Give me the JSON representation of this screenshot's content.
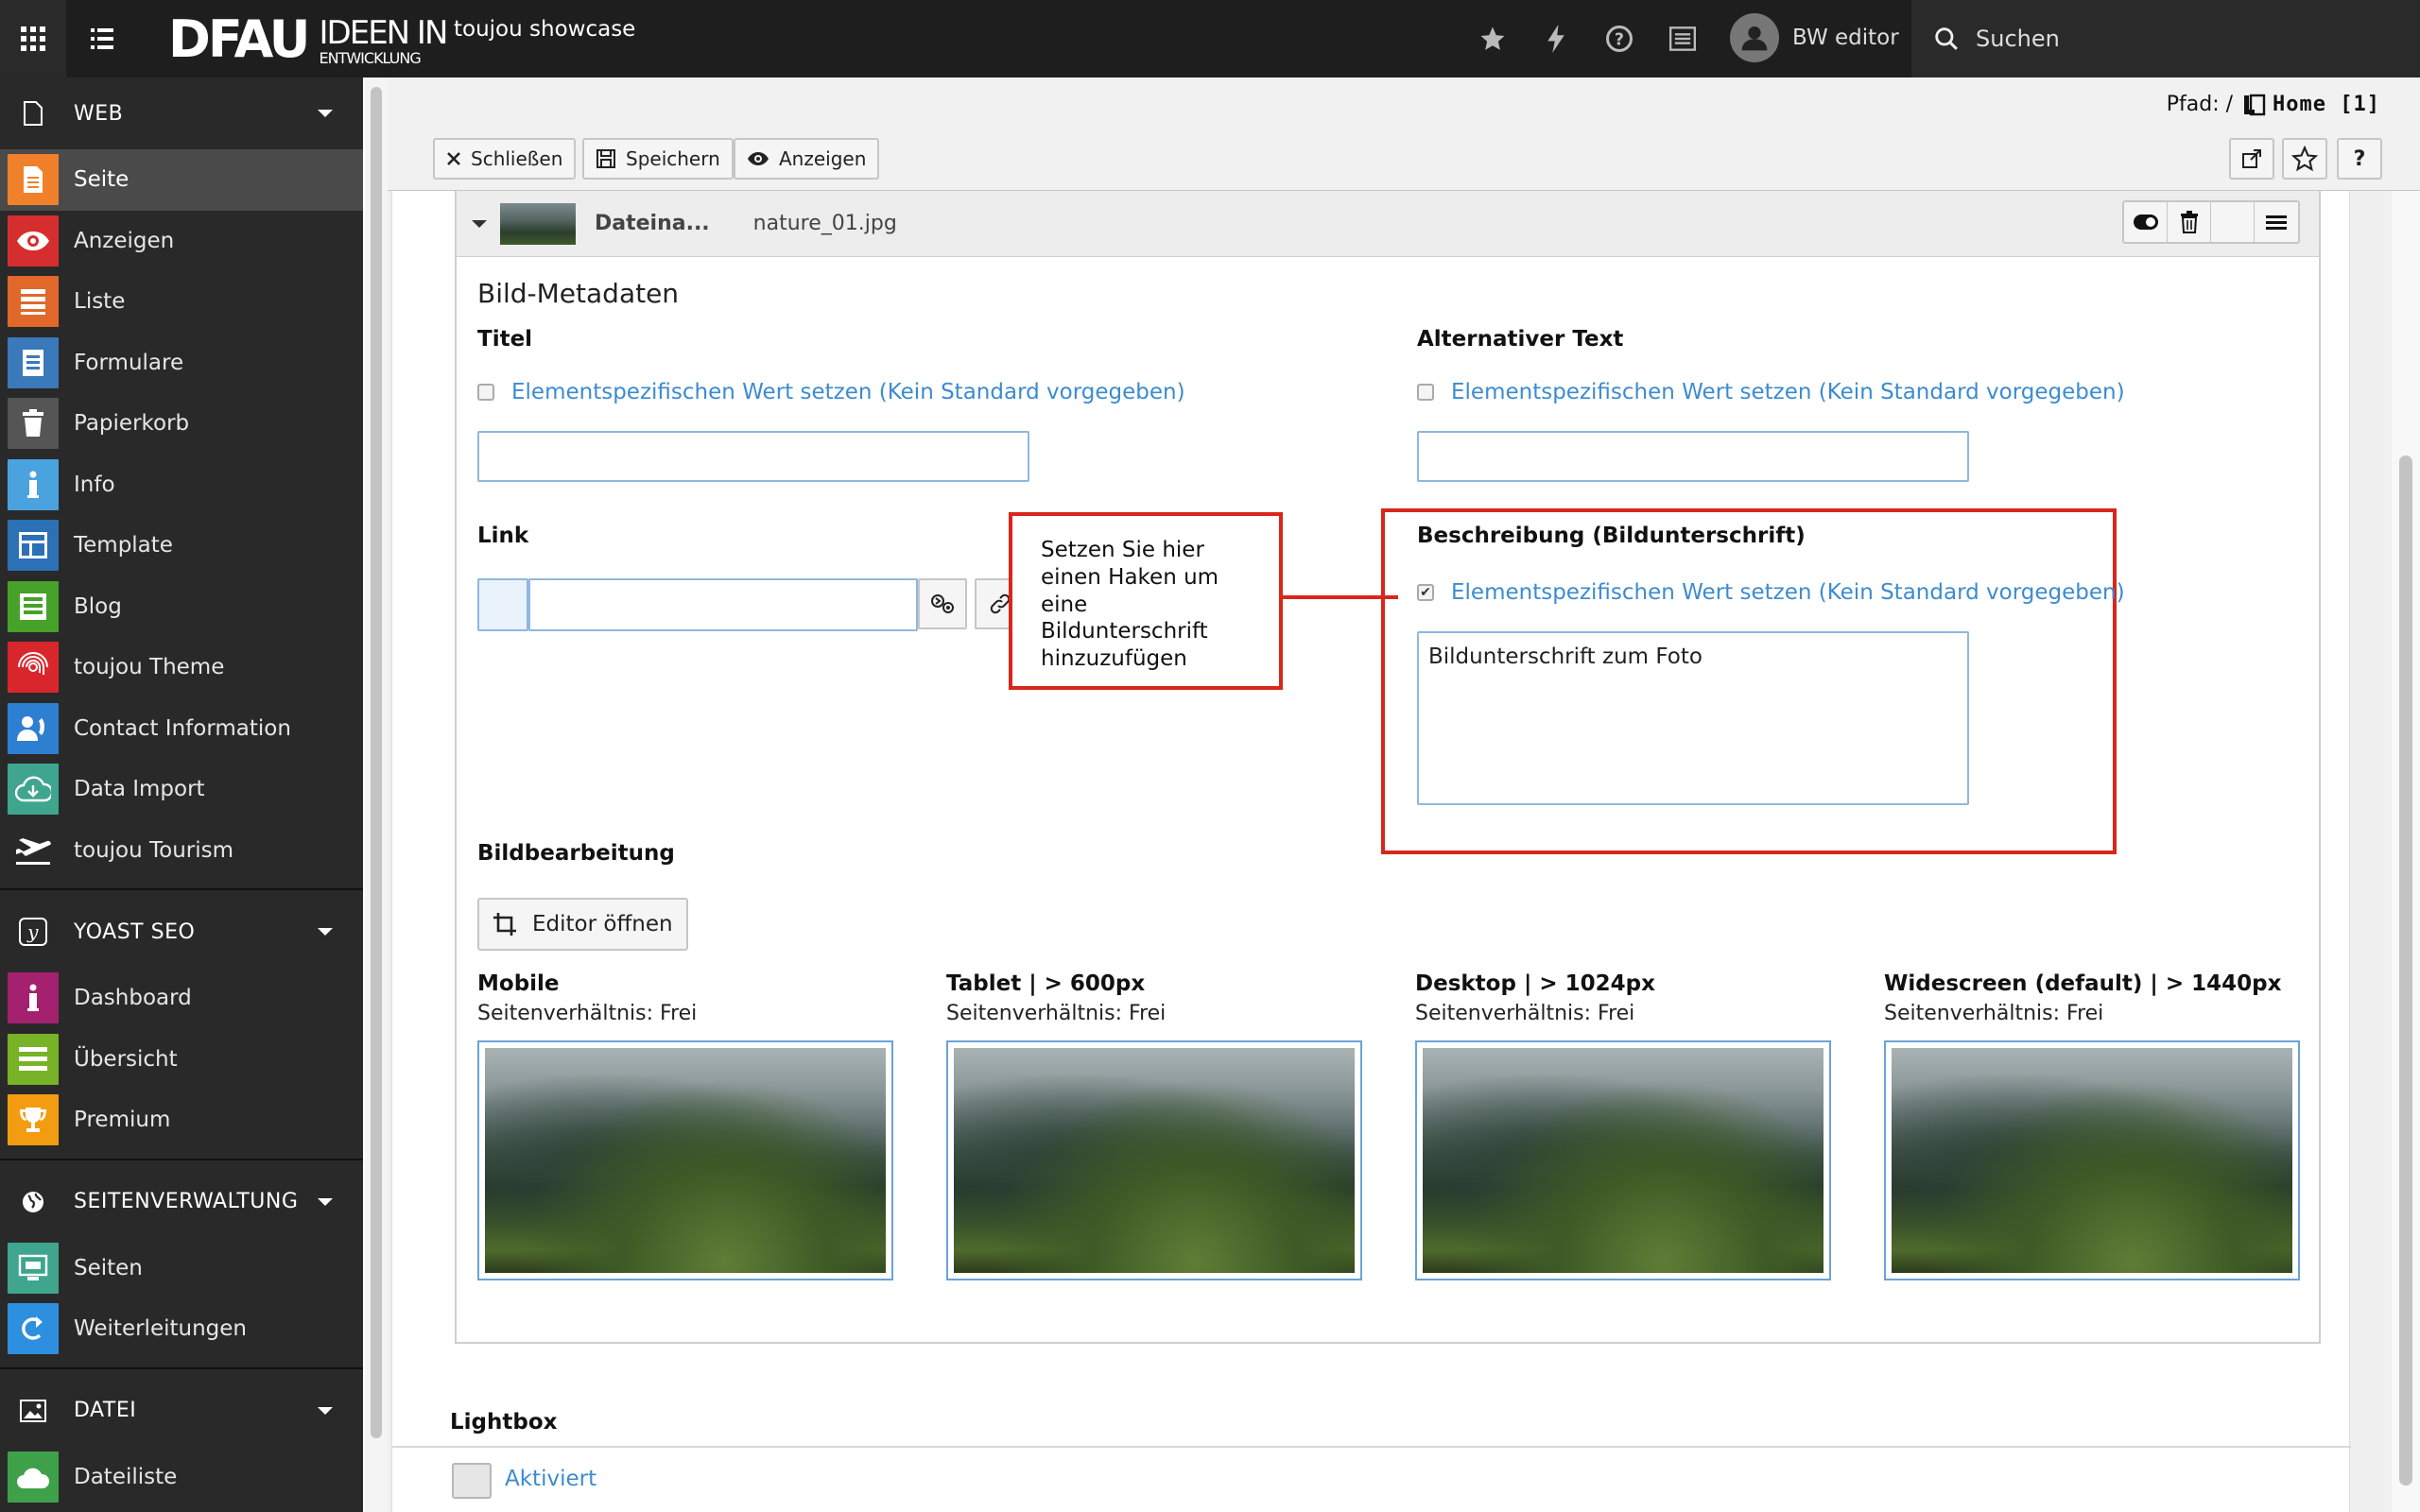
{
  "topbar": {
    "logo_main": "DFAU",
    "logo_line1": "IDEEN IN",
    "logo_line2": "ENTWICKLUNG",
    "site_name": "toujou showcase",
    "user_name": "BW editor",
    "search_label": "Suchen"
  },
  "sidebar": {
    "groups": [
      {
        "label": "WEB",
        "items": [
          {
            "label": "Seite",
            "color": "#f0812a",
            "active": true
          },
          {
            "label": "Anzeigen",
            "color": "#d62e2e"
          },
          {
            "label": "Liste",
            "color": "#e0682b"
          },
          {
            "label": "Formulare",
            "color": "#3a79ba"
          },
          {
            "label": "Papierkorb",
            "color": "#555555"
          },
          {
            "label": "Info",
            "color": "#4aa3df"
          },
          {
            "label": "Template",
            "color": "#2c70b5"
          },
          {
            "label": "Blog",
            "color": "#46a229"
          },
          {
            "label": "toujou Theme",
            "color": "#d9262c"
          },
          {
            "label": "Contact Information",
            "color": "#2d7fd1"
          },
          {
            "label": "Data Import",
            "color": "#3fa58e"
          },
          {
            "label": "toujou Tourism",
            "color": "#292929"
          }
        ]
      },
      {
        "label": "YOAST SEO",
        "items": [
          {
            "label": "Dashboard",
            "color": "#a3216f"
          },
          {
            "label": "Übersicht",
            "color": "#77b227"
          },
          {
            "label": "Premium",
            "color": "#f39c12"
          }
        ]
      },
      {
        "label": "SEITENVERWALTUNG",
        "items": [
          {
            "label": "Seiten",
            "color": "#3fa58e"
          },
          {
            "label": "Weiterleitungen",
            "color": "#2d8fe0"
          }
        ]
      },
      {
        "label": "DATEI",
        "items": [
          {
            "label": "Dateiliste",
            "color": "#3fa04a"
          }
        ]
      }
    ]
  },
  "docheader": {
    "path_label": "Pfad: /",
    "path_page": "Home [1]",
    "close_label": "Schließen",
    "save_label": "Speichern",
    "view_label": "Anzeigen",
    "help_label": "?"
  },
  "panel": {
    "header_label": "Dateina...",
    "file_name": "nature_01.jpg",
    "section_title": "Bild-Metadaten",
    "title_label": "Titel",
    "alt_label": "Alternativer Text",
    "override_text": "Elementspezifischen Wert setzen (Kein Standard vorgegeben)",
    "title_value": "",
    "alt_value": "",
    "link_label": "Link",
    "link_value": "",
    "desc_label": "Beschreibung (Bildunterschrift)",
    "desc_value": "Bildunterschrift zum Foto",
    "desc_checked": true,
    "callout_text": "Setzen Sie hier einen Haken um eine Bildunterschrift hinzuzufügen",
    "image_edit_label": "Bildbearbeitung",
    "editor_button": "Editor öffnen",
    "crops": [
      {
        "title": "Mobile",
        "ratio": "Seitenverhältnis: Frei"
      },
      {
        "title": "Tablet | > 600px",
        "ratio": "Seitenverhältnis: Frei"
      },
      {
        "title": "Desktop | > 1024px",
        "ratio": "Seitenverhältnis: Frei"
      },
      {
        "title": "Widescreen (default) | > 1440px",
        "ratio": "Seitenverhältnis: Frei"
      }
    ]
  },
  "lightbox": {
    "label": "Lightbox",
    "toggle_label": "Aktiviert"
  }
}
